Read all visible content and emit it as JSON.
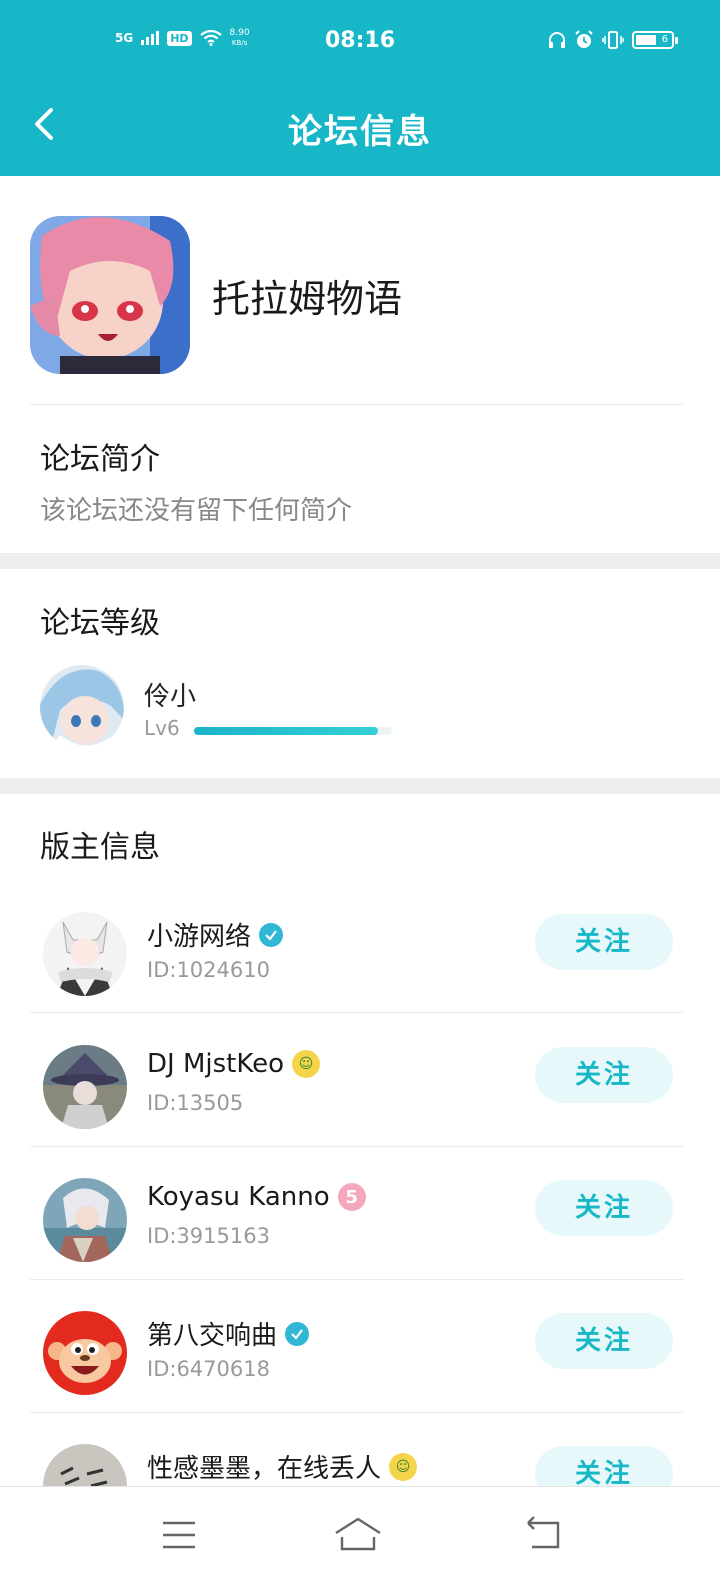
{
  "statusbar": {
    "network": "5G",
    "hd": "HD",
    "speed_value": "8.90",
    "speed_unit": "KB/s",
    "time": "08:16",
    "battery_level": "6"
  },
  "header": {
    "title": "论坛信息"
  },
  "forum": {
    "name": "托拉姆物语"
  },
  "intro": {
    "title": "论坛简介",
    "text": "该论坛还没有留下任何简介"
  },
  "level": {
    "title": "论坛等级",
    "name": "伶小",
    "tag": "Lv6",
    "progress": 0.93
  },
  "moderators": {
    "title": "版主信息",
    "follow_label": "关注",
    "items": [
      {
        "name": "小游网络",
        "id": "ID:1024610"
      },
      {
        "name": "DJ MjstKeo",
        "id": "ID:13505"
      },
      {
        "name": "Koyasu Kanno",
        "id": "ID:3915163"
      },
      {
        "name": "第八交响曲",
        "id": "ID:6470618"
      },
      {
        "name": "性感墨墨，在线丢人",
        "id": ""
      }
    ]
  },
  "colors": {
    "accent": "#17b7c7",
    "follow_bg": "#e6f8f9",
    "band": "#ededed"
  }
}
